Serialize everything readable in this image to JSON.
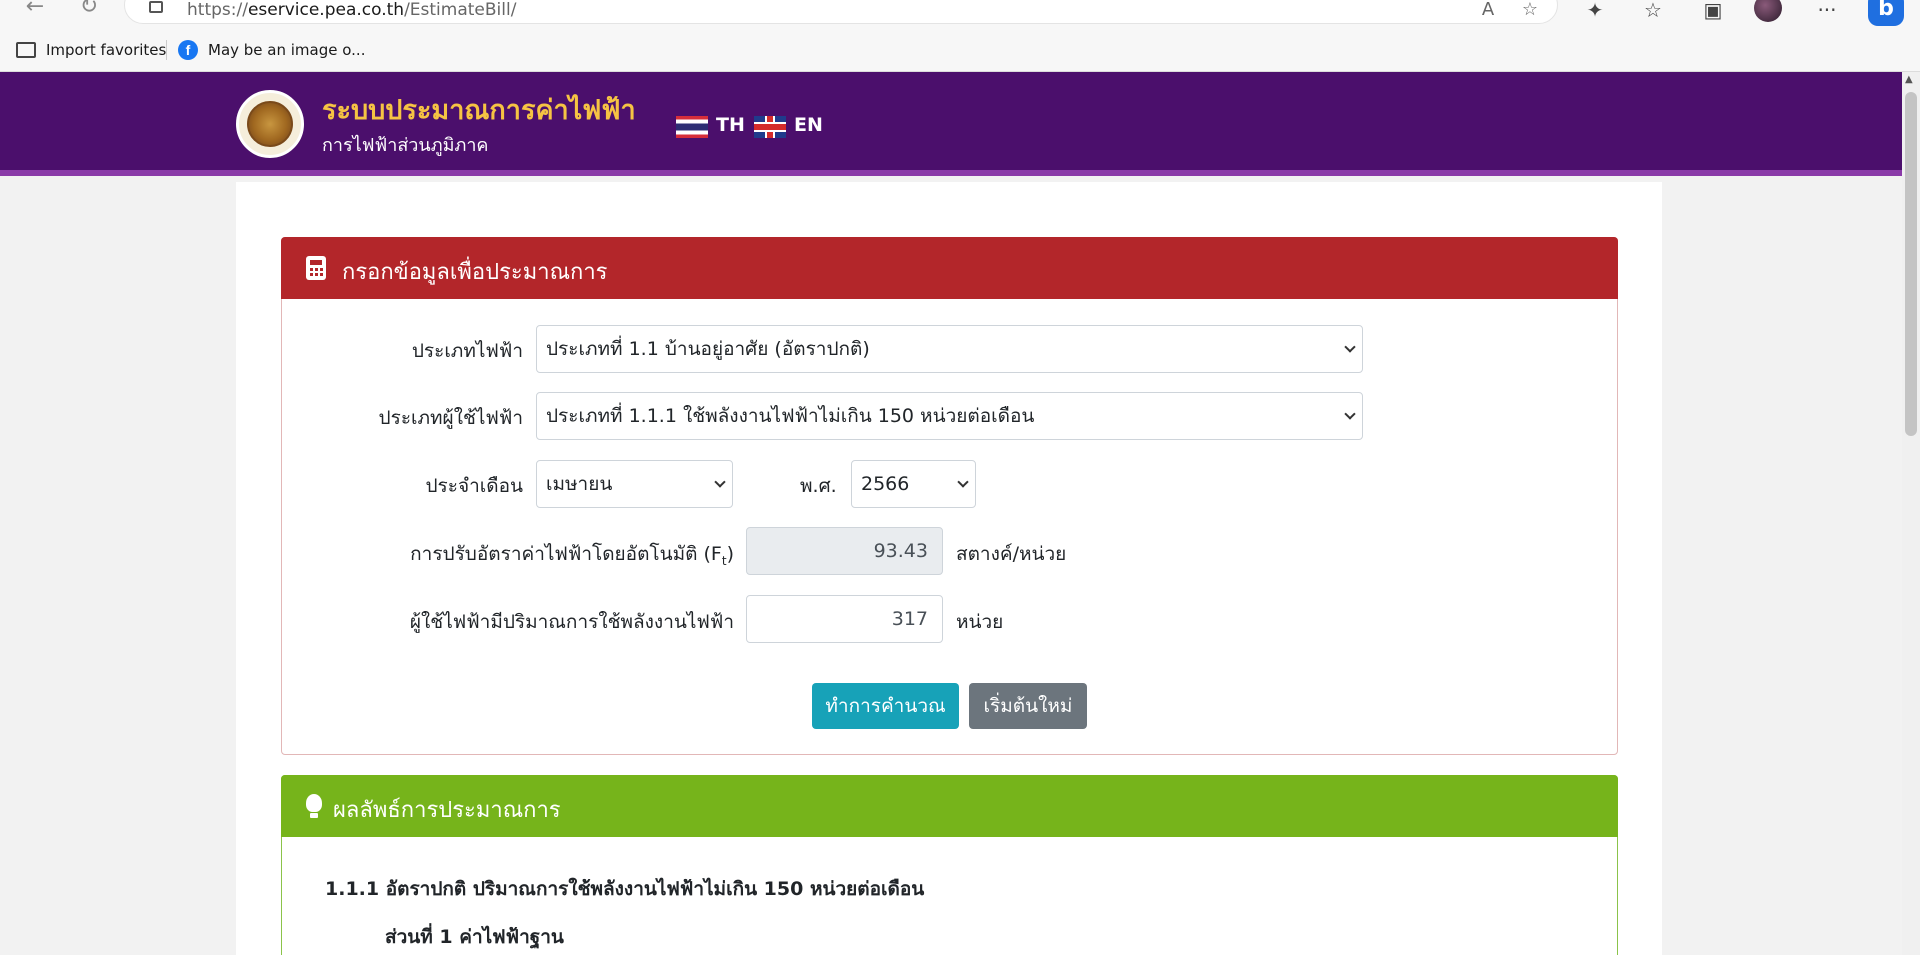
{
  "browser": {
    "url_prefix": "https://",
    "url_host": "eservice.pea.co.th",
    "url_path": "/EstimateBill/",
    "favorites": [
      {
        "label": "Import favorites"
      },
      {
        "label": "May be an image o..."
      }
    ]
  },
  "header": {
    "title": "ระบบประมาณการค่าไฟฟ้า",
    "subtitle": "การไฟฟ้าส่วนภูมิภาค",
    "lang_th": "TH",
    "lang_en": "EN"
  },
  "form_panel": {
    "title": "กรอกข้อมูลเพื่อประมาณการ",
    "electricity_type_label": "ประเภทไฟฟ้า",
    "electricity_type_value": "ประเภทที่ 1.1 บ้านอยู่อาศัย (อัตราปกติ)",
    "user_type_label": "ประเภทผู้ใช้ไฟฟ้า",
    "user_type_value": "ประเภทที่ 1.1.1 ใช้พลังงานไฟฟ้าไม่เกิน 150 หน่วยต่อเดือน",
    "month_label": "ประจำเดือน",
    "month_value": "เมษายน",
    "year_label": "พ.ศ.",
    "year_value": "2566",
    "ft_label": "การปรับอัตราค่าไฟฟ้าโดยอัตโนมัติ (F",
    "ft_sub": "t",
    "ft_label_end": ")",
    "ft_value": "93.43",
    "ft_unit": "สตางค์/หน่วย",
    "usage_label": "ผู้ใช้ไฟฟ้ามีปริมาณการใช้พลังงานไฟฟ้า",
    "usage_value": "317",
    "usage_unit": "หน่วย",
    "calc_button": "ทำการคำนวณ",
    "reset_button": "เริ่มต้นใหม่"
  },
  "result_panel": {
    "title": "ผลลัพธ์การประมาณการ",
    "heading": "1.1.1 อัตราปกติ ปริมาณการใช้พลังงานไฟฟ้าไม่เกิน 150 หน่วยต่อเดือน",
    "section1": "ส่วนที่ 1 ค่าไฟฟ้าฐาน"
  },
  "colors": {
    "header_purple": "#4b0f6c",
    "title_gold": "#f6c343",
    "form_red": "#b3262a",
    "result_green": "#76b41b",
    "calc_button": "#17a2b8",
    "reset_button": "#6c757d"
  }
}
